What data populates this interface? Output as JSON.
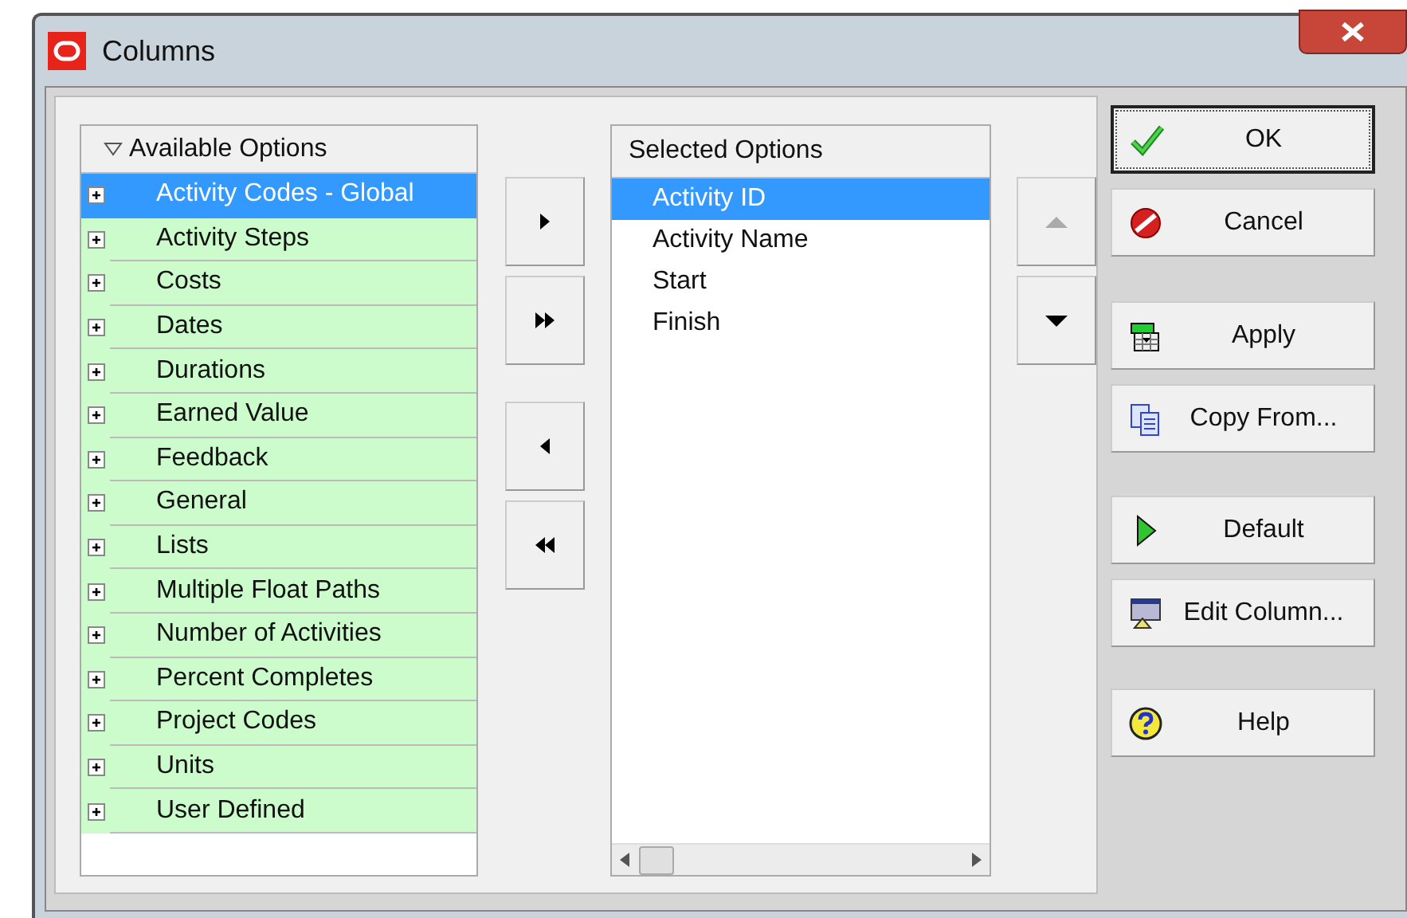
{
  "window": {
    "title": "Columns"
  },
  "available": {
    "header": "Available Options",
    "expanded": true,
    "items": [
      {
        "label": "Activity Codes - Global",
        "selected": true
      },
      {
        "label": "Activity Steps",
        "selected": false
      },
      {
        "label": "Costs",
        "selected": false
      },
      {
        "label": "Dates",
        "selected": false
      },
      {
        "label": "Durations",
        "selected": false
      },
      {
        "label": "Earned Value",
        "selected": false
      },
      {
        "label": "Feedback",
        "selected": false
      },
      {
        "label": "General",
        "selected": false
      },
      {
        "label": "Lists",
        "selected": false
      },
      {
        "label": "Multiple Float Paths",
        "selected": false
      },
      {
        "label": "Number of Activities",
        "selected": false
      },
      {
        "label": "Percent Completes",
        "selected": false
      },
      {
        "label": "Project Codes",
        "selected": false
      },
      {
        "label": "Units",
        "selected": false
      },
      {
        "label": "User Defined",
        "selected": false
      }
    ]
  },
  "transfer_buttons": [
    {
      "kind": "add"
    },
    {
      "kind": "add_all"
    },
    {
      "kind": "remove"
    },
    {
      "kind": "remove_all"
    }
  ],
  "selected_options": {
    "header": "Selected Options",
    "items": [
      {
        "label": "Activity ID",
        "selected": true
      },
      {
        "label": "Activity Name",
        "selected": false
      },
      {
        "label": "Start",
        "selected": false
      },
      {
        "label": "Finish",
        "selected": false
      }
    ]
  },
  "move_buttons": [
    {
      "kind": "up",
      "disabled": true
    },
    {
      "kind": "down",
      "disabled": false
    }
  ],
  "actions": [
    {
      "label": "OK",
      "kind": "ok",
      "default": true
    },
    {
      "label": "Cancel",
      "kind": "cancel",
      "default": false
    },
    {
      "label": "Apply",
      "kind": "apply",
      "default": false
    },
    {
      "label": "Copy From...",
      "kind": "copy",
      "default": false
    },
    {
      "label": "Default",
      "kind": "default",
      "default": false
    },
    {
      "label": "Edit Column...",
      "kind": "edit",
      "default": false
    },
    {
      "label": "Help",
      "kind": "help",
      "default": false
    }
  ]
}
